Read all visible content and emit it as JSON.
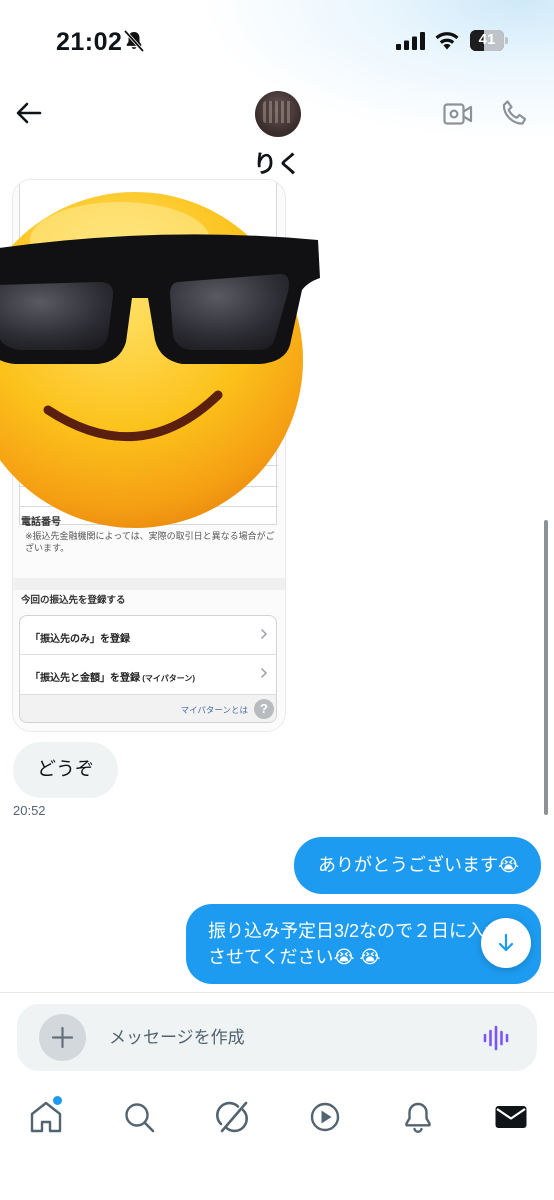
{
  "status_bar": {
    "time": "21:02",
    "battery_level": "41",
    "battery_fraction": 0.41,
    "icons": [
      "bell-off-icon",
      "cellular-signal-icon",
      "wifi-icon",
      "battery-icon"
    ]
  },
  "header": {
    "contact_name": "りく",
    "back_icon": "arrow-left-icon",
    "video_icon": "video-call-icon",
    "phone_icon": "phone-icon"
  },
  "shared_image": {
    "phone_label": "電話番号",
    "note": "※振込先金融機関によっては、実際の取引日と異なる場合がございます。",
    "section_title": "今回の振込先を登録する",
    "options": [
      {
        "label": "「振込先のみ」を登録",
        "sub": ""
      },
      {
        "label": "「振込先と金額」を登録",
        "sub": " (マイパターン)"
      }
    ],
    "help_link": "マイパターンとは",
    "help_symbol": "?",
    "sticker": "smiling-face-with-sunglasses-emoji"
  },
  "messages": {
    "incoming": {
      "text": "どうぞ",
      "time": "20:52"
    },
    "outgoing": [
      {
        "text": "ありがとうございます😭"
      },
      {
        "text": "振り込み予定日3/2なので２日に入金させてください😭 😭"
      }
    ]
  },
  "composer": {
    "placeholder": "メッセージを作成",
    "add_icon": "plus-icon",
    "voice_icon": "voice-waveform-icon"
  },
  "bottom_nav": {
    "items": [
      "home-icon",
      "search-icon",
      "grok-icon",
      "video-play-icon",
      "notifications-icon",
      "messages-icon"
    ],
    "active": "messages-icon",
    "home_has_badge": true
  },
  "colors": {
    "accent": "#1d9bf0",
    "incoming_bubble": "#eff3f4",
    "voice_icon": "#7856ff"
  }
}
